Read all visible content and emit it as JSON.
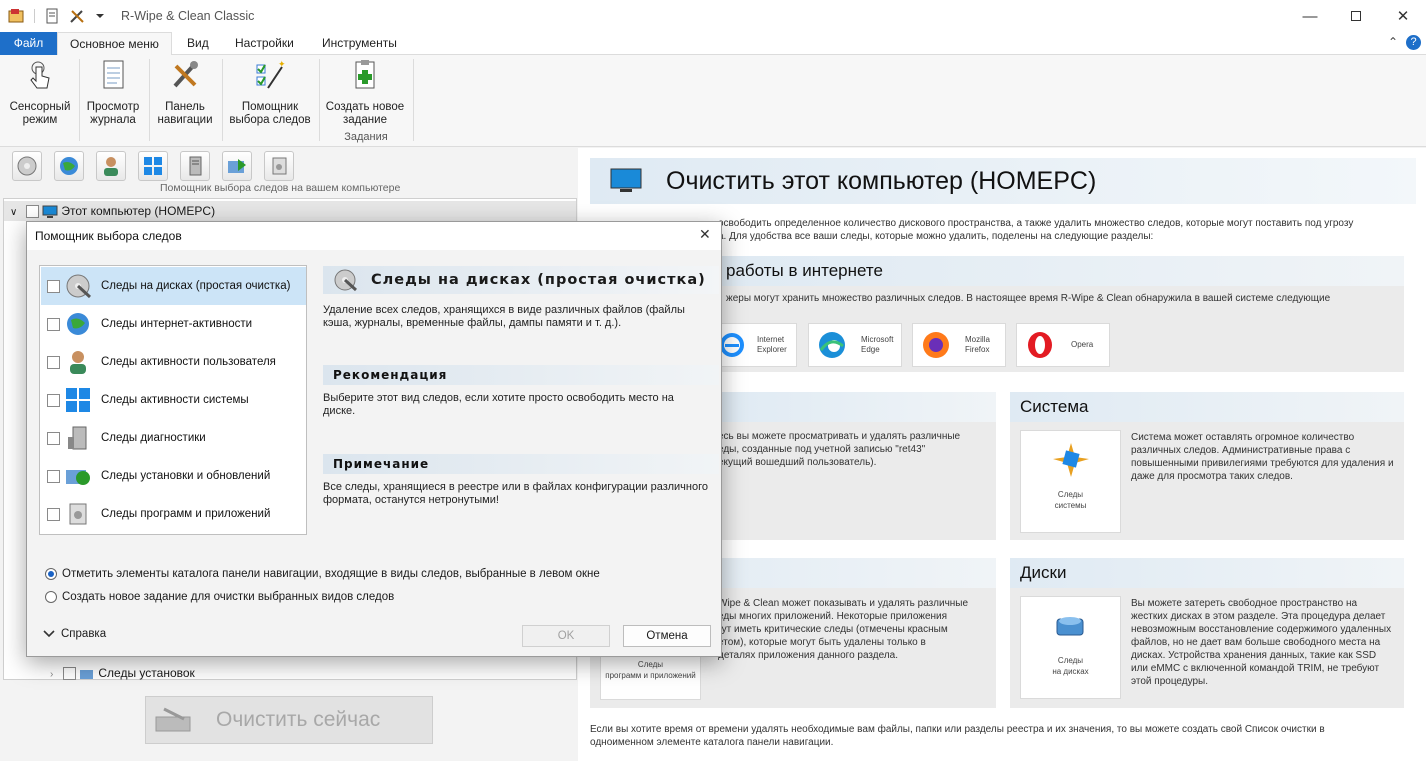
{
  "window": {
    "title": "R-Wipe & Clean Classic",
    "minimize_icon": "minimize-icon",
    "maximize_icon": "maximize-icon",
    "close_icon": "close-icon"
  },
  "ribbon": {
    "tabs": [
      "Файл",
      "Основное меню",
      "Вид",
      "Настройки",
      "Инструменты"
    ],
    "buttons": [
      {
        "label1": "Сенсорный",
        "label2": "режим",
        "icon": "touch-icon"
      },
      {
        "label1": "Просмотр",
        "label2": "журнала",
        "icon": "log-icon"
      },
      {
        "label1": "Панель",
        "label2": "навигации",
        "icon": "tools-icon"
      },
      {
        "label1": "Помощник",
        "label2": "выбора следов",
        "icon": "wizard-icon"
      },
      {
        "label1": "Создать новое",
        "label2": "задание",
        "icon": "new-task-icon"
      }
    ],
    "group_label": "Задания"
  },
  "left": {
    "toolbar_caption": "Помощник выбора следов на вашем компьютере",
    "tree_root": "Этот компьютер  (HOMEPC)",
    "tree_bottom_item": "Следы установок",
    "clean_button": "Очистить сейчас"
  },
  "right": {
    "title": "Очистить этот компьютер  (HOMEPC)",
    "intro": "освободить определенное количество дискового пространства, а также удалить множество следов, которые могут поставить под угрозу",
    "intro2": "а. Для удобства все ваши следы, которые можно удалить, поделены на следующие разделы:",
    "internet_head": "работы в интернете",
    "internet_text": "жеры могут хранить множество различных следов. В настоящее время R-Wipe & Clean обнаружила в вашей системе следующие",
    "browsers": [
      {
        "l1": "Internet",
        "l2": "Explorer"
      },
      {
        "l1": "Microsoft",
        "l2": "Edge"
      },
      {
        "l1": "Mozilla",
        "l2": "Firefox"
      },
      {
        "l1": "Opera",
        "l2": ""
      }
    ],
    "user_text": [
      "есь вы можете просматривать и удалять различные",
      "еды, созданные под учетной записью \"ret43\"",
      "екущий вошедший пользователь)."
    ],
    "system_head": "Система",
    "system_tile": [
      "Следы",
      "системы"
    ],
    "system_text": [
      "Система может оставлять огромное количество",
      "различных следов. Административные права с",
      "повышенными привилегиями требуются для удаления и",
      "даже для просмотра таких следов."
    ],
    "apps_text": [
      "Wipe & Clean может показывать и удалять различные",
      "еды многих приложений. Некоторые приложения",
      "гут иметь критические следы (отмечены красным",
      "етом), которые могут быть удалены только в",
      "деталях приложения данного раздела."
    ],
    "apps_tile": [
      "Следы",
      "программ и приложений"
    ],
    "disks_head": "Диски",
    "disks_tile": [
      "Следы",
      "на дисках"
    ],
    "disks_text": [
      "Вы можете затереть свободное пространство на",
      "жестких дисках в этом разделе. Эта процедура делает",
      "невозможным восстановление содержимого удаленных",
      "файлов, но не дает вам больше свободного места на",
      "дисках. Устройства хранения данных, такие как SSD",
      "или eMMC с включенной командой TRIM, не требуют",
      "этой процедуры."
    ],
    "footer1": "Если вы хотите время от времени удалять необходимые вам файлы, папки или разделы реестра и их значения, то вы можете создать свой Список очистки в",
    "footer2": "одноименном элементе каталога  панели навигации."
  },
  "dialog": {
    "title": "Помощник выбора следов",
    "items": [
      {
        "label": "Следы на дисках (простая очистка)",
        "icon": "disk-broom-icon"
      },
      {
        "label": "Следы интернет-активности",
        "icon": "globe-icon"
      },
      {
        "label": "Следы активности пользователя",
        "icon": "user-icon"
      },
      {
        "label": "Следы активности системы",
        "icon": "windows-icon"
      },
      {
        "label": "Следы диагностики",
        "icon": "diagnostics-icon"
      },
      {
        "label": "Следы установки и обновлений",
        "icon": "update-icon"
      },
      {
        "label": "Следы программ и приложений",
        "icon": "apps-icon"
      }
    ],
    "detail_title": "Следы на дисках (простая очистка)",
    "detail_desc1": "Удаление всех следов, хранящихся в виде различных файлов (файлы",
    "detail_desc2": "кэша, журналы, временные файлы, дампы памяти и т. д.).",
    "recommend_head": "Рекомендация",
    "recommend1": "Выберите этот вид следов, если хотите просто освободить место на",
    "recommend2": "диске.",
    "note_head": "Примечание",
    "note1": "Все следы, хранящиеся в реестре или в файлах конфигурации различного",
    "note2": "формата, останутся нетронутыми!",
    "radio1": "Отметить элементы каталога панели навигации, входящие в виды следов, выбранные в левом окне",
    "radio2": "Создать новое задание для очистки выбранных видов следов",
    "help": "Справка",
    "ok": "OK",
    "cancel": "Отмена"
  }
}
